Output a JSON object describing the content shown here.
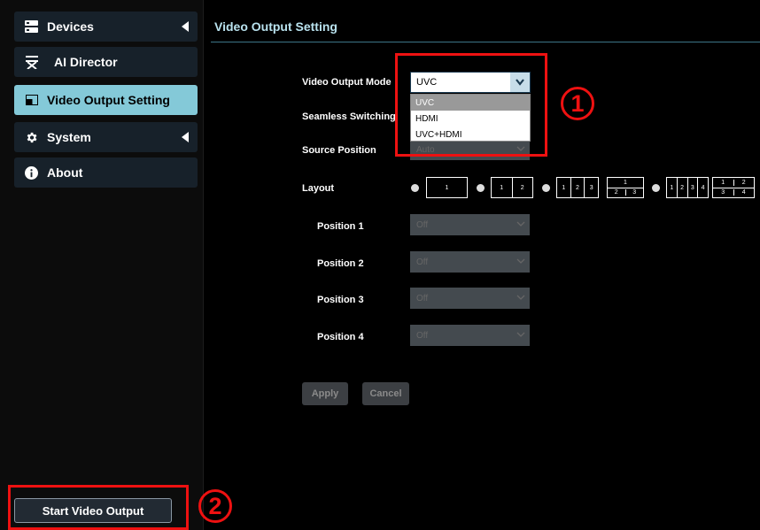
{
  "sidebar": {
    "items": [
      {
        "label": "Devices",
        "icon": "devices-icon"
      },
      {
        "label": "AI Director",
        "icon": "director-chair-icon"
      },
      {
        "label": "Video Output Setting",
        "icon": "monitor-icon"
      },
      {
        "label": "System",
        "icon": "gear-icon"
      },
      {
        "label": "About",
        "icon": "info-icon"
      }
    ],
    "start_button": "Start Video Output"
  },
  "header": {
    "title": "Video Output Setting"
  },
  "form": {
    "mode_label": "Video Output Mode",
    "mode_value": "UVC",
    "mode_options": [
      "UVC",
      "HDMI",
      "UVC+HDMI"
    ],
    "seamless_label": "Seamless Switching",
    "source_label": "Source Position",
    "source_value": "Auto",
    "layout_label": "Layout",
    "positions": [
      {
        "label": "Position 1",
        "value": "Off"
      },
      {
        "label": "Position 2",
        "value": "Off"
      },
      {
        "label": "Position 3",
        "value": "Off"
      },
      {
        "label": "Position 4",
        "value": "Off"
      }
    ],
    "apply": "Apply",
    "cancel": "Cancel"
  },
  "annotations": {
    "one": "1",
    "two": "2"
  },
  "colors": {
    "accent": "#84c9d8",
    "title": "#b9e2ee",
    "annotation": "#ee1111"
  }
}
